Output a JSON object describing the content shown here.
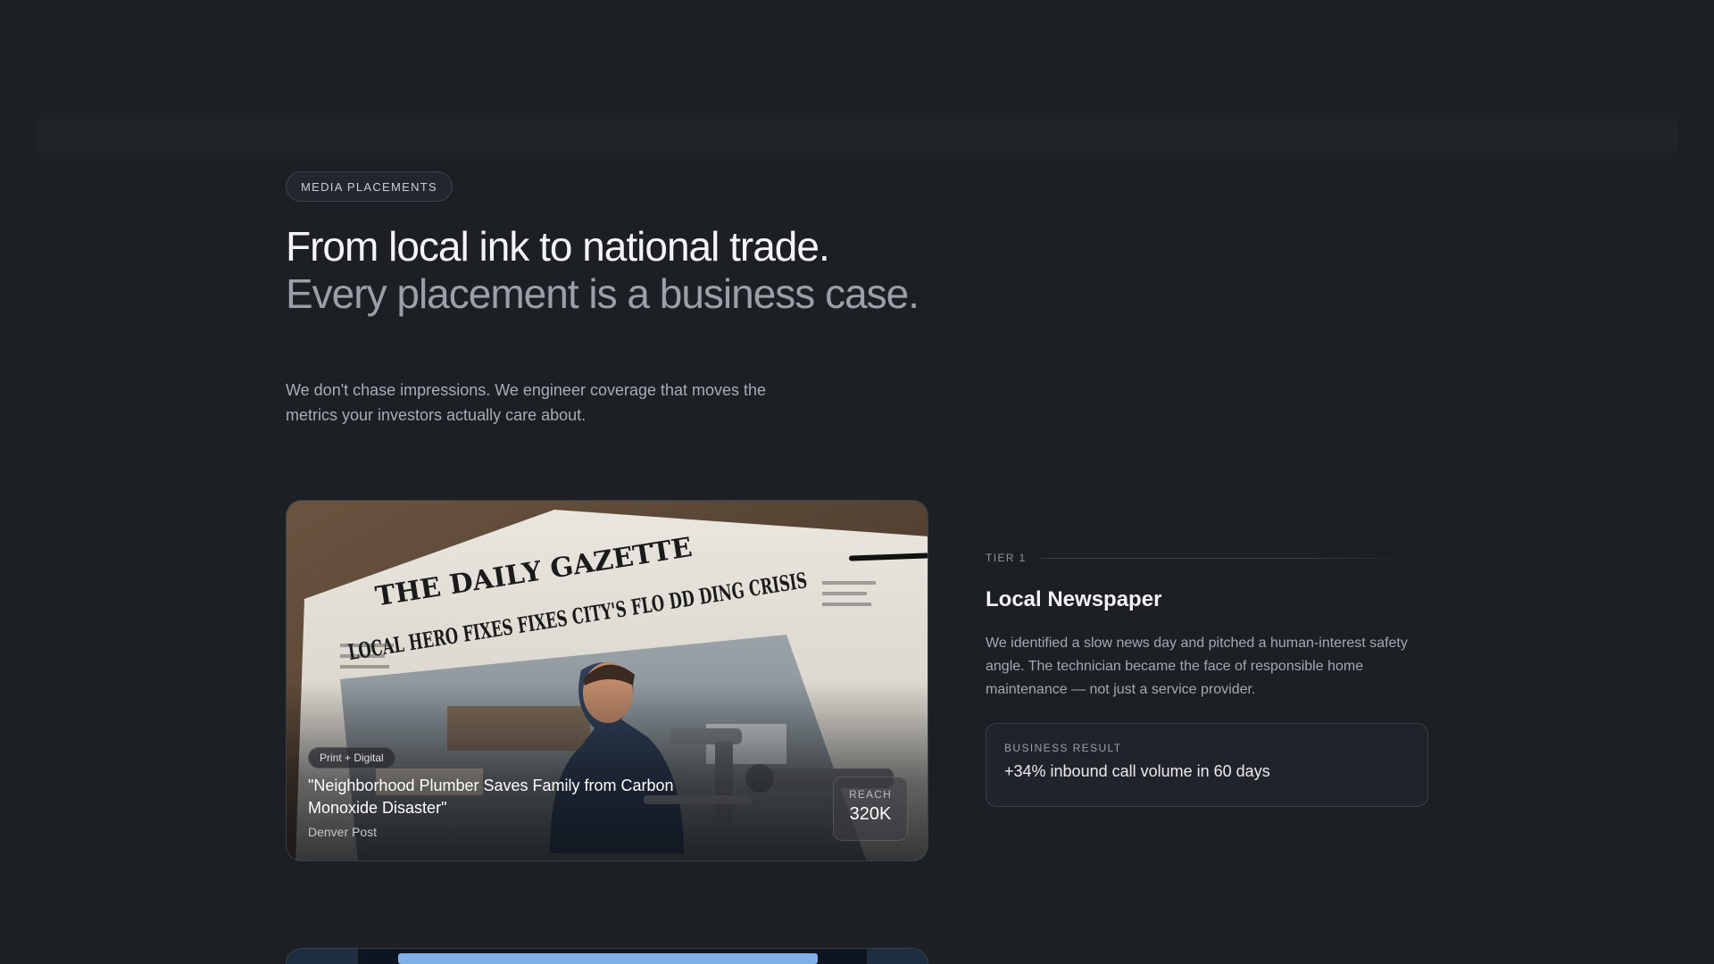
{
  "section": {
    "badge": "MEDIA PLACEMENTS",
    "headline_line1": "From local ink to national trade.",
    "headline_line2": "Every placement is a business case.",
    "lede": "We don't chase impressions. We engineer coverage that moves the metrics your investors actually care about."
  },
  "placement": {
    "image": {
      "masthead": "THE DAILY GAZETTE",
      "headline": "LOCAL HERO FIXES FIXES CITY'S FLO DD DING CRISIS"
    },
    "chip": "Print + Digital",
    "title": "\"Neighborhood Plumber Saves Family from Carbon Monoxide Disaster\"",
    "source": "Denver Post",
    "reach_label": "REACH",
    "reach_value": "320K"
  },
  "detail": {
    "tier": "TIER 1",
    "title": "Local Newspaper",
    "description": "We identified a slow news day and pitched a human-interest safety angle. The technician became the face of responsible home maintenance — not just a service provider.",
    "result_label": "BUSINESS RESULT",
    "result_value": "+34% inbound call volume in 60 days"
  },
  "colors": {
    "background": "#1c1f24",
    "card_border": "#3a3e45",
    "heading": "#f4f5f7",
    "muted_heading": "#9aa0a8"
  }
}
